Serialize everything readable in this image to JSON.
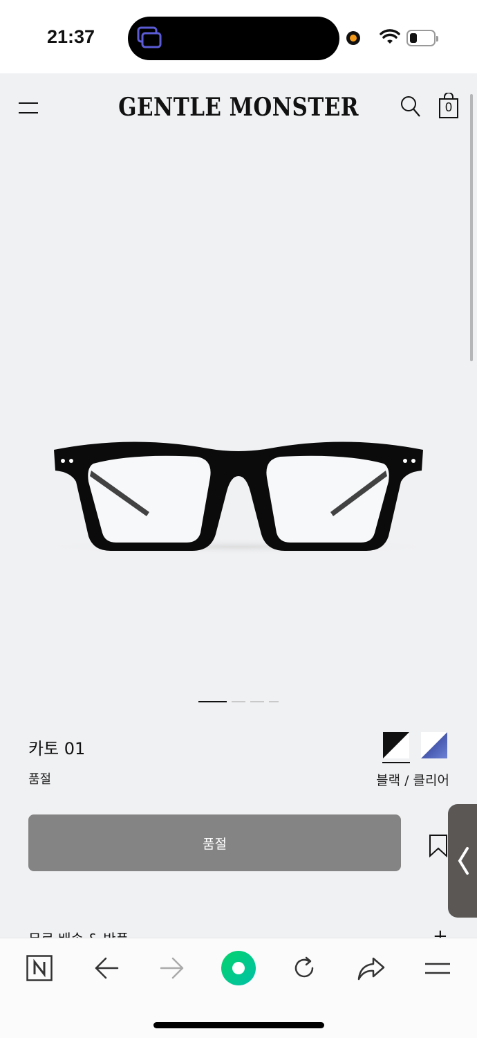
{
  "status_bar": {
    "time": "21:37"
  },
  "header": {
    "brand": "GENTLE MONSTER",
    "cart_count": "0"
  },
  "product": {
    "name": "카토 01",
    "availability": "품절",
    "color_name": "블랙 / 클리어",
    "image_count": 4,
    "active_image": 1,
    "swatches": [
      {
        "name": "black-clear",
        "colors": [
          "#111111",
          "#ffffff"
        ],
        "selected": true
      },
      {
        "name": "blue-clear",
        "colors": [
          "#2a3e9c",
          "#ffffff"
        ],
        "selected": false
      }
    ]
  },
  "actions": {
    "soldout_button": "품절"
  },
  "info": {
    "shipping_label": "무료 배송 & 반품",
    "expand_symbol": "+"
  },
  "colors": {
    "background": "#f0f1f3",
    "button_disabled": "#848484",
    "naver_green": "#03c75a"
  }
}
